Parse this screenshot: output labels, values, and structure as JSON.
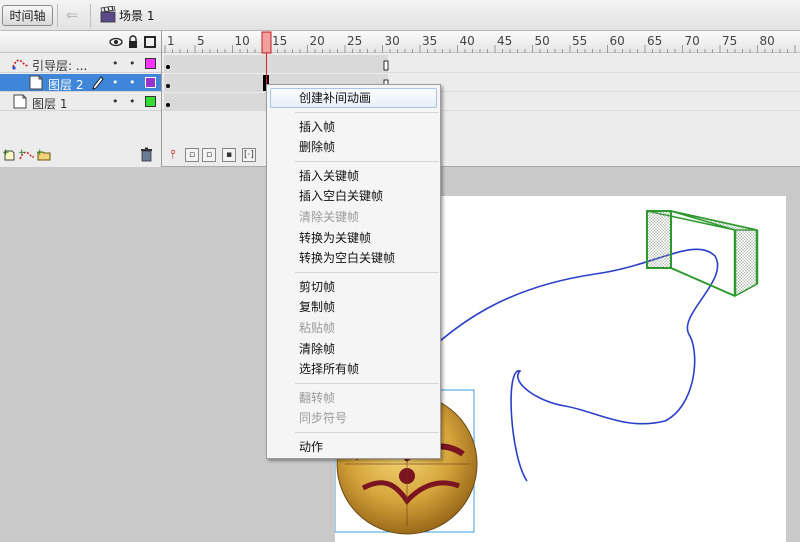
{
  "toolbar": {
    "timeline_button": "时间轴",
    "scene_label": "场景 1",
    "back_icon": "back-arrow-icon",
    "scene_icon": "clapperboard-icon"
  },
  "layers": {
    "header_icons": [
      "eye-icon",
      "lock-icon",
      "outline-icon"
    ],
    "items": [
      {
        "name": "引导层: ...",
        "icon": "guide-layer-icon",
        "color": "#ff33ff",
        "selected": false
      },
      {
        "name": "图层 2",
        "icon": "layer-icon",
        "color": "#9933cc",
        "selected": true
      },
      {
        "name": "图层 1",
        "icon": "layer-icon",
        "color": "#33dd33",
        "selected": false
      }
    ],
    "footer_icons": [
      "new-layer-icon",
      "add-guide-icon",
      "new-folder-icon",
      "trash-icon"
    ]
  },
  "ruler": {
    "ticks": [
      "1",
      "5",
      "10",
      "15",
      "20",
      "25",
      "30",
      "35",
      "40",
      "45",
      "50",
      "55",
      "60",
      "65",
      "70",
      "75",
      "80"
    ],
    "playhead_frame": 15
  },
  "context_menu": {
    "items": [
      {
        "label": "创建补间动画",
        "disabled": false,
        "highlighted": true
      },
      {
        "separator": true
      },
      {
        "label": "插入帧",
        "disabled": false
      },
      {
        "label": "删除帧",
        "disabled": false
      },
      {
        "separator": true
      },
      {
        "label": "插入关键帧",
        "disabled": false
      },
      {
        "label": "插入空白关键帧",
        "disabled": false
      },
      {
        "label": "清除关键帧",
        "disabled": true
      },
      {
        "label": "转换为关键帧",
        "disabled": false
      },
      {
        "label": "转换为空白关键帧",
        "disabled": false
      },
      {
        "separator": true
      },
      {
        "label": "剪切帧",
        "disabled": false
      },
      {
        "label": "复制帧",
        "disabled": false
      },
      {
        "label": "粘贴帧",
        "disabled": true
      },
      {
        "label": "清除帧",
        "disabled": false
      },
      {
        "label": "选择所有帧",
        "disabled": false
      },
      {
        "separator": true
      },
      {
        "label": "翻转帧",
        "disabled": true
      },
      {
        "label": "同步符号",
        "disabled": true
      },
      {
        "separator": true
      },
      {
        "label": "动作",
        "disabled": false
      }
    ]
  },
  "stage": {
    "objects": [
      "soccer-ball",
      "soccer-goal",
      "motion-guide-path"
    ],
    "path_color": "#2b3fc9",
    "goal_color": "#2e9a2e"
  }
}
